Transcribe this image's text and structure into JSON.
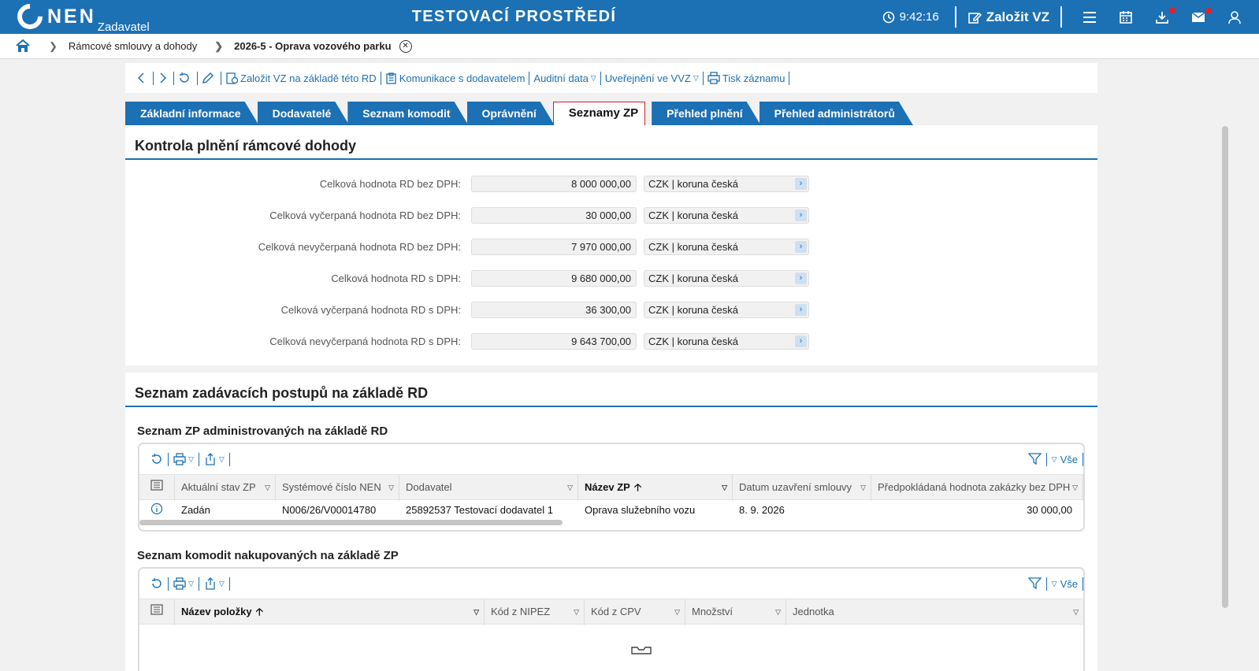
{
  "header": {
    "logo_text": "NEN",
    "logo_sub": "Zadavatel",
    "environment": "TESTOVACÍ PROSTŘEDÍ",
    "time": "9:42:16",
    "create_label": "Založit VZ"
  },
  "breadcrumb": {
    "items": [
      "Rámcové smlouvy a dohody",
      "2026-5 - Oprava vozového parku"
    ]
  },
  "toolbar": {
    "create_from_rd": "Založit VZ na základě této RD",
    "communication": "Komunikace s dodavatelem",
    "audit": "Auditní data",
    "publish": "Uveřejnění ve VVZ",
    "print": "Tisk záznamu"
  },
  "tabs": [
    "Základní informace",
    "Dodavatelé",
    "Seznam komodit",
    "Oprávnění",
    "Seznamy ZP",
    "Přehled plnění",
    "Přehled administrátorů"
  ],
  "active_tab": "Seznamy ZP",
  "control": {
    "title": "Kontrola plnění rámcové dohody",
    "rows": [
      {
        "label": "Celková hodnota RD bez DPH:",
        "value": "8 000 000,00",
        "currency": "CZK | koruna česká"
      },
      {
        "label": "Celková vyčerpaná hodnota RD bez DPH:",
        "value": "30 000,00",
        "currency": "CZK | koruna česká"
      },
      {
        "label": "Celková nevyčerpaná hodnota RD bez DPH:",
        "value": "7 970 000,00",
        "currency": "CZK | koruna česká"
      },
      {
        "label": "Celková hodnota RD s DPH:",
        "value": "9 680 000,00",
        "currency": "CZK | koruna česká"
      },
      {
        "label": "Celková vyčerpaná hodnota RD s DPH:",
        "value": "36 300,00",
        "currency": "CZK | koruna česká"
      },
      {
        "label": "Celková nevyčerpaná hodnota RD s DPH:",
        "value": "9 643 700,00",
        "currency": "CZK | koruna česká"
      }
    ]
  },
  "zp_section": {
    "title": "Seznam zadávacích postupů na základě RD",
    "admin_title": "Seznam ZP administrovaných na základě RD",
    "filter_all": "Vše",
    "columns": [
      "Aktuální stav ZP",
      "Systémové číslo NEN",
      "Dodavatel",
      "Název ZP",
      "Datum uzavření smlouvy",
      "Předpokládaná hodnota zakázky bez DPH"
    ],
    "rows": [
      [
        "Zadán",
        "N006/26/V00014780",
        "25892537 Testovací dodavatel 1",
        "Oprava služebního vozu",
        "8. 9. 2026",
        "30 000,00"
      ]
    ]
  },
  "commodities": {
    "title": "Seznam komodit nakupovaných na základě ZP",
    "filter_all": "Vše",
    "columns": [
      "Název položky",
      "Kód z NIPEZ",
      "Kód z CPV",
      "Množství",
      "Jednotka"
    ]
  }
}
